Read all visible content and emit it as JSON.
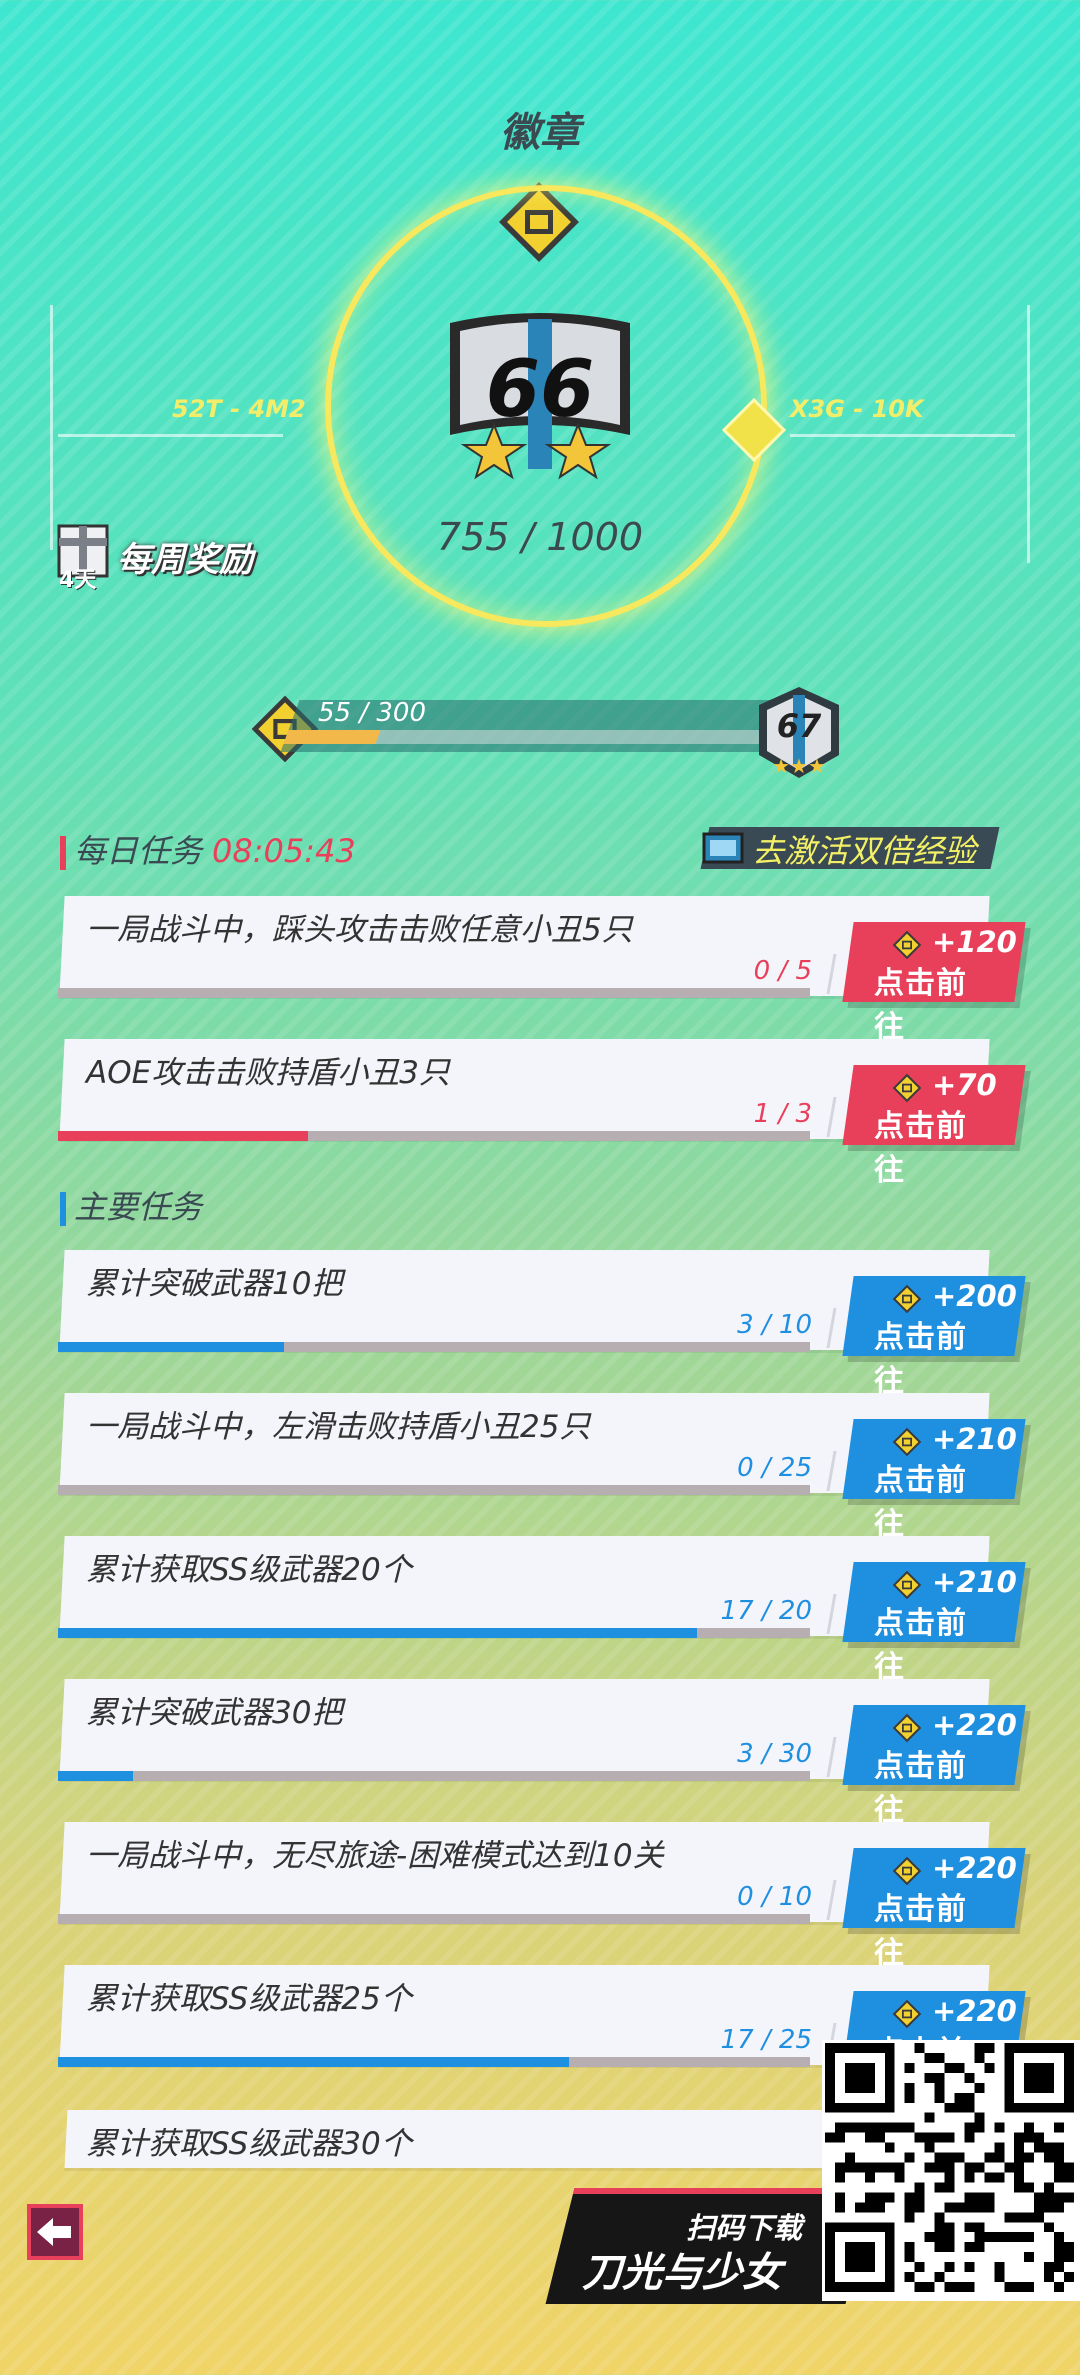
{
  "header": {
    "title": "徽章"
  },
  "badge": {
    "level": "66",
    "progress": "755 / 1000",
    "left_range": "52T - 4M2",
    "right_range": "X3G - 10K"
  },
  "weekly_reward": {
    "label": "每周奖励",
    "days": "4天"
  },
  "level_bar": {
    "text": "55 / 300",
    "current": 55,
    "max": 300,
    "next_level": "67"
  },
  "daily": {
    "title": "每日任务",
    "timer": "08:05:43",
    "double_exp_label": "去激活双倍经验",
    "tasks": [
      {
        "text": "一局战斗中，踩头攻击击败任意小丑5只",
        "count": "0 / 5",
        "progress": 0.0,
        "reward": "+120",
        "go": "点击前往"
      },
      {
        "text": "AOE攻击击败持盾小丑3只",
        "count": "1 / 3",
        "progress": 0.333,
        "reward": "+70",
        "go": "点击前往"
      }
    ]
  },
  "main": {
    "title": "主要任务",
    "tasks": [
      {
        "text": "累计突破武器10把",
        "count": "3 / 10",
        "progress": 0.3,
        "reward": "+200",
        "go": "点击前往"
      },
      {
        "text": "一局战斗中，左滑击败持盾小丑25只",
        "count": "0 / 25",
        "progress": 0.0,
        "reward": "+210",
        "go": "点击前往"
      },
      {
        "text": "累计获取SS级武器20个",
        "count": "17 / 20",
        "progress": 0.85,
        "reward": "+210",
        "go": "点击前往"
      },
      {
        "text": "累计突破武器30把",
        "count": "3 / 30",
        "progress": 0.1,
        "reward": "+220",
        "go": "点击前往"
      },
      {
        "text": "一局战斗中，无尽旅途-困难模式达到10关",
        "count": "0 / 10",
        "progress": 0.0,
        "reward": "+220",
        "go": "点击前往"
      },
      {
        "text": "累计获取SS级武器25个",
        "count": "17 / 25",
        "progress": 0.68,
        "reward": "+220",
        "go": "点击前往"
      },
      {
        "text": "累计获取SS级武器30个",
        "count": "",
        "progress": 0.0,
        "reward": "",
        "go": ""
      }
    ]
  },
  "promo": {
    "scan_label": "扫码下载",
    "game_name": "刀光与少女"
  },
  "colors": {
    "daily_accent": "#e8405a",
    "main_accent": "#1f8fe0",
    "bar_gold": "#f2b94a"
  },
  "icons": {
    "back": "back-arrow-icon",
    "coin": "medal-coin-icon",
    "qr": "qr-code"
  }
}
